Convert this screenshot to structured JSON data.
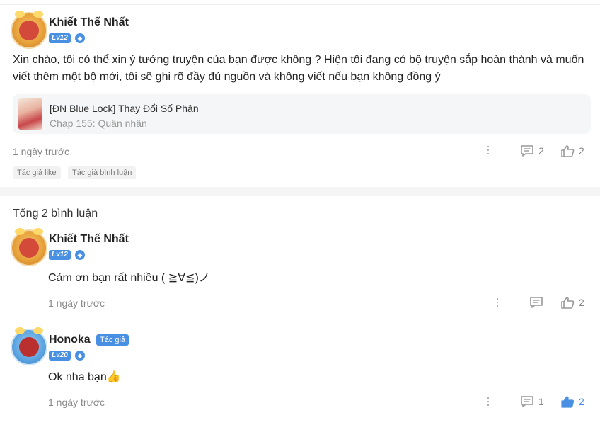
{
  "comment": {
    "user": "Khiết Thế Nhất",
    "level": "Lv12",
    "text_line1": "Xin chào, tôi có thể xin ý tưởng truyện của bạn được không ? Hiện tôi đang có bộ truyện sắp hoàn thành và muốn",
    "text_line2": "viết thêm một bộ mới, tôi sẽ ghi rõ đầy đủ nguồn và không viết nếu bạn không đồng ý",
    "story": {
      "title": "[ĐN Blue Lock] Thay Đổi Số Phận",
      "chapter": "Chap 155: Quân nhân"
    },
    "time": "1 ngày trước",
    "reply_count": "2",
    "like_count": "2",
    "tags": [
      "Tác giả like",
      "Tác giả bình luận"
    ]
  },
  "replies_header": "Tổng 2 bình luận",
  "replies": [
    {
      "user": "Khiết Thế Nhất",
      "level": "Lv12",
      "text": "Cảm ơn bạn rất nhiều ( ≧∀≦)ノ",
      "time": "1 ngày trước",
      "reply_count": "",
      "like_count": "2"
    },
    {
      "user": "Honoka",
      "author_badge": "Tác giả",
      "level": "Lv20",
      "text": "Ok nha bạn👍",
      "time": "1 ngày trước",
      "reply_count": "1",
      "like_count": "2",
      "liked": true
    }
  ],
  "colors": {
    "accent": "#4a90e2",
    "muted": "#888888"
  }
}
